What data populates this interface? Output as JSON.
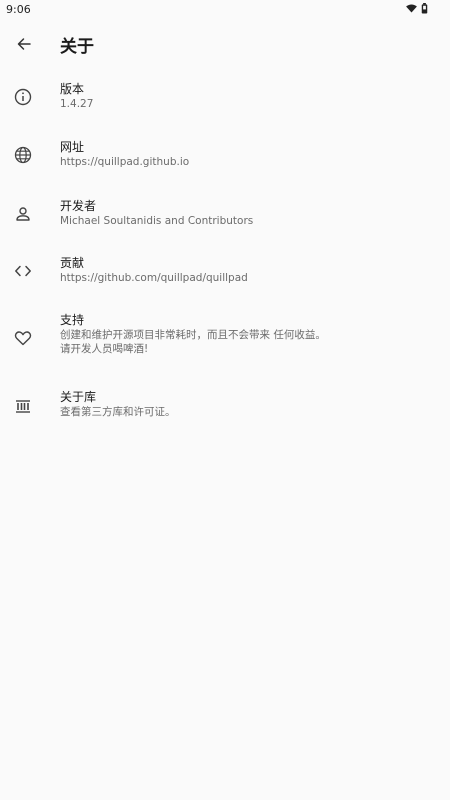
{
  "status": {
    "time": "9:06"
  },
  "header": {
    "title": "关于"
  },
  "items": [
    {
      "title": "版本",
      "subtitle": "1.4.27"
    },
    {
      "title": "网址",
      "subtitle": "https://quillpad.github.io"
    },
    {
      "title": "开发者",
      "subtitle": "Michael Soultanidis and Contributors"
    },
    {
      "title": "贡献",
      "subtitle": "https://github.com/quillpad/quillpad"
    },
    {
      "title": "支持",
      "subtitle": "创建和维护开源项目非常耗时，而且不会带来 任何收益。\n请开发人员喝啤酒!"
    },
    {
      "title": "关于库",
      "subtitle": "查看第三方库和许可证。"
    }
  ]
}
